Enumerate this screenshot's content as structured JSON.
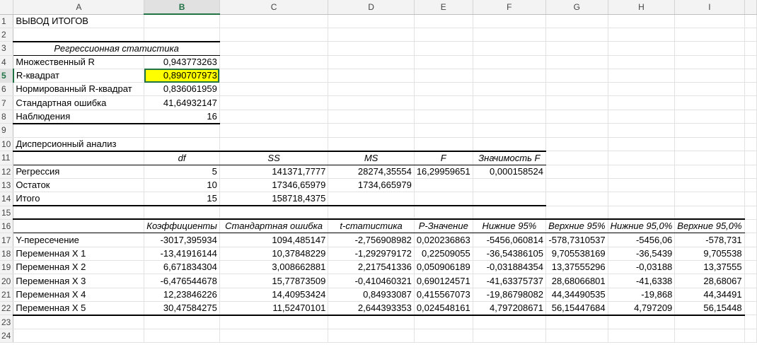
{
  "columns": [
    "A",
    "B",
    "C",
    "D",
    "E",
    "F",
    "G",
    "H",
    "I"
  ],
  "selected_column": "B",
  "selected_row": "5",
  "rows": {
    "r1": {
      "num": "1",
      "a": "ВЫВОД ИТОГОВ"
    },
    "r2": {
      "num": "2"
    },
    "r3": {
      "num": "3",
      "title": "Регрессионная статистика"
    },
    "r4": {
      "num": "4",
      "label": "Множественный R",
      "value": "0,943773263"
    },
    "r5": {
      "num": "5",
      "label": "R-квадрат",
      "value": "0,890707973"
    },
    "r6": {
      "num": "6",
      "label": "Нормированный R-квадрат",
      "value": "0,836061959"
    },
    "r7": {
      "num": "7",
      "label": "Стандартная ошибка",
      "value": "41,64932147"
    },
    "r8": {
      "num": "8",
      "label": "Наблюдения",
      "value": "16"
    },
    "r9": {
      "num": "9"
    },
    "r10": {
      "num": "10",
      "a": "Дисперсионный анализ"
    },
    "r11": {
      "num": "11",
      "b": "df",
      "c": "SS",
      "d": "MS",
      "e": "F",
      "f": "Значимость F"
    },
    "r12": {
      "num": "12",
      "a": "Регрессия",
      "b": "5",
      "c": "141371,7777",
      "d": "28274,35554",
      "e": "16,29959651",
      "f": "0,000158524"
    },
    "r13": {
      "num": "13",
      "a": "Остаток",
      "b": "10",
      "c": "17346,65979",
      "d": "1734,665979"
    },
    "r14": {
      "num": "14",
      "a": "Итого",
      "b": "15",
      "c": "158718,4375"
    },
    "r15": {
      "num": "15"
    },
    "r16": {
      "num": "16",
      "b": "Коэффициенты",
      "c": "Стандартная ошибка",
      "d": "t-статистика",
      "e": "P-Значение",
      "f": "Нижние 95%",
      "g": "Верхние 95%",
      "h": "Нижние 95,0%",
      "i": "Верхние 95,0%"
    },
    "r17": {
      "num": "17",
      "a": "Y-пересечение",
      "b": "-3017,395934",
      "c": "1094,485147",
      "d": "-2,756908982",
      "e": "0,020236863",
      "f": "-5456,060814",
      "g": "-578,7310537",
      "h": "-5456,06",
      "i": "-578,731"
    },
    "r18": {
      "num": "18",
      "a": "Переменная X 1",
      "b": "-13,41916144",
      "c": "10,37848229",
      "d": "-1,292979172",
      "e": "0,22509055",
      "f": "-36,54386105",
      "g": "9,705538169",
      "h": "-36,5439",
      "i": "9,705538"
    },
    "r19": {
      "num": "19",
      "a": "Переменная X 2",
      "b": "6,671834304",
      "c": "3,008662881",
      "d": "2,217541336",
      "e": "0,050906189",
      "f": "-0,031884354",
      "g": "13,37555296",
      "h": "-0,03188",
      "i": "13,37555"
    },
    "r20": {
      "num": "20",
      "a": "Переменная X 3",
      "b": "-6,476544678",
      "c": "15,77873509",
      "d": "-0,410460321",
      "e": "0,690124571",
      "f": "-41,63375737",
      "g": "28,68066801",
      "h": "-41,6338",
      "i": "28,68067"
    },
    "r21": {
      "num": "21",
      "a": "Переменная X 4",
      "b": "12,23846226",
      "c": "14,40953424",
      "d": "0,84933087",
      "e": "0,415567073",
      "f": "-19,86798082",
      "g": "44,34490535",
      "h": "-19,868",
      "i": "44,34491"
    },
    "r22": {
      "num": "22",
      "a": "Переменная X 5",
      "b": "30,47584275",
      "c": "11,52470101",
      "d": "2,644393353",
      "e": "0,024548161",
      "f": "4,797208671",
      "g": "56,15447684",
      "h": "4,797209",
      "i": "56,15448"
    },
    "r23": {
      "num": "23"
    },
    "r24": {
      "num": "24"
    }
  },
  "colors": {
    "selection": "#217346",
    "highlight": "#ffff00"
  }
}
